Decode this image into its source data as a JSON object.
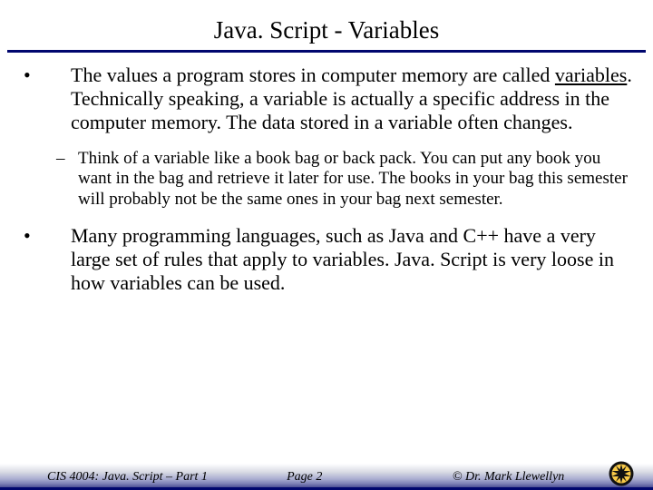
{
  "title": "Java. Script - Variables",
  "bullets": {
    "b1_pre": "The values a program stores in computer memory are called ",
    "b1_underlined": "variables",
    "b1_post": ".  Technically speaking, a variable is actually a specific address in the computer memory.  The data stored in a variable often changes.",
    "dash1": "Think of a variable like a book bag or back pack.  You can put any book you want in the bag and retrieve it later for use.  The books in your bag this semester will probably not be the same ones in your bag next semester.",
    "b2": "Many programming languages, such as Java and C++ have a very large set of rules that apply to variables.  Java. Script is very loose in how variables can be used."
  },
  "footer": {
    "left": "CIS 4004: Java. Script – Part 1",
    "center": "Page 2",
    "right": "© Dr. Mark Llewellyn"
  },
  "markers": {
    "bullet": "•",
    "dash": "–"
  }
}
